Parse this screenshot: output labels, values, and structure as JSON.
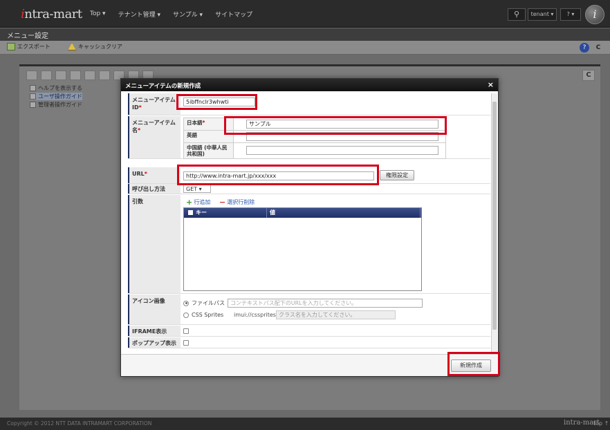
{
  "header": {
    "logo_mark": "i",
    "logo_text": "ntra-mart",
    "nav": [
      "Top ▾",
      "テナント管理 ▾",
      "サンプル ▾",
      "サイトマップ"
    ],
    "search_icon": "⚲",
    "user": "tenant ▾",
    "help": "? ▾",
    "avatar_letter": "i"
  },
  "page": {
    "title": "メニュー設定"
  },
  "toolbar": {
    "export_label": "エクスポート",
    "clear_cache_label": "キャッシュクリア",
    "help_icon": "?",
    "refresh_icon": "C"
  },
  "panel": {
    "refresh_icon": "C",
    "tree": [
      {
        "label": "ヘルプを表示する"
      },
      {
        "label": "ユーザ操作ガイド"
      },
      {
        "label": "管理者操作ガイド"
      }
    ]
  },
  "modal": {
    "title": "メニューアイテムの新規作成",
    "close": "×",
    "menu_item_id_label": "メニューアイテムID",
    "menu_item_id_value": "5ibffnclr3whwti",
    "menu_item_name_label": "メニューアイテム名",
    "name_rows": [
      {
        "lang": "日本語",
        "required": "*",
        "value": "サンプル"
      },
      {
        "lang": "英語",
        "required": "",
        "value": ""
      },
      {
        "lang": "中国語 (中華人民共和国)",
        "required": "",
        "value": ""
      }
    ],
    "url_label": "URL",
    "url_value": "http://www.intra-mart.jp/xxx/xxx",
    "auth_button": "権限設定",
    "call_method_label": "呼び出し方法",
    "call_method_value": "GET ▾",
    "args_label": "引数",
    "add_row": "行追加",
    "delete_row": "選択行削除",
    "grid_headers": [
      "キー",
      "値"
    ],
    "icon_label": "アイコン画像",
    "file_path_label": "ファイルパス",
    "file_path_placeholder": "コンテキストパス配下のURLを入力してください。",
    "css_sprites_label": "CSS Sprites",
    "css_prefix": "imui://cssprites/",
    "css_placeholder": "クラス名を入力してください。",
    "iframe_label": "IFRAME表示",
    "popup_label": "ポップアップ表示",
    "required_mark": "*",
    "create_button": "新規作成"
  },
  "footer": {
    "copyright": "Copyright © 2012 NTT DATA INTRAMART CORPORATION",
    "logo": "intra-mart",
    "top_link": "top ↑"
  }
}
